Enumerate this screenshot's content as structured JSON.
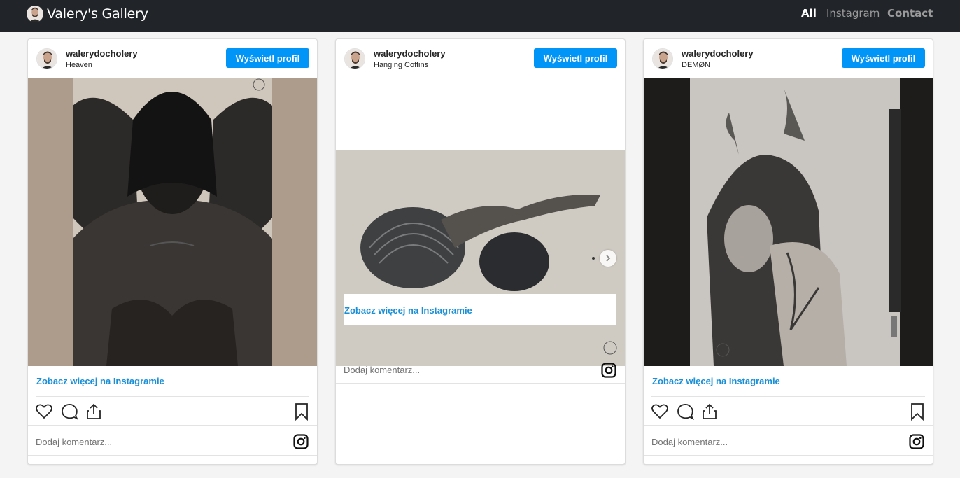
{
  "app": {
    "title": "Valery's Gallery"
  },
  "nav": {
    "all": "All",
    "instagram": "Instagram",
    "contact": "Contact"
  },
  "accent_color": "#0095f6",
  "link_color": "#1a8fd6",
  "posts": [
    {
      "username": "walerydocholery",
      "caption": "Heaven",
      "profile_button": "Wyświetl profil",
      "more_link": "Zobacz więcej na Instagramie",
      "comment_placeholder": "Dodaj komentarz..."
    },
    {
      "username": "walerydocholery",
      "caption": "Hanging Coffins",
      "profile_button": "Wyświetl profil",
      "more_link": "Zobacz więcej na Instagramie",
      "comment_placeholder": "Dodaj komentarz..."
    },
    {
      "username": "walerydocholery",
      "caption": "DEMØN",
      "profile_button": "Wyświetl profil",
      "more_link": "Zobacz więcej na Instagramie",
      "comment_placeholder": "Dodaj komentarz..."
    }
  ]
}
